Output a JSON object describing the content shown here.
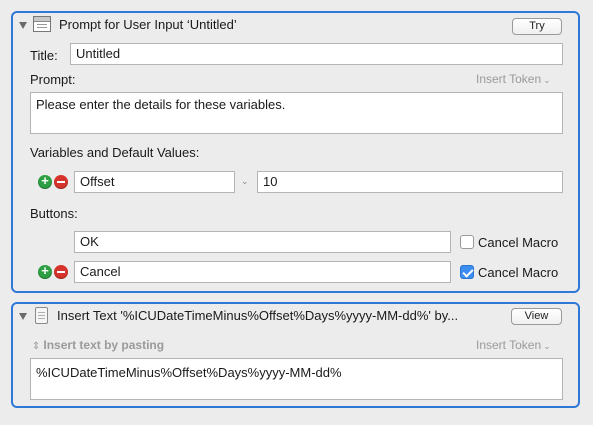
{
  "prompt_action": {
    "title": "Prompt for User Input ‘Untitled’",
    "try_label": "Try",
    "title_label": "Title:",
    "title_value": "Untitled",
    "prompt_label": "Prompt:",
    "insert_token_label": "Insert Token",
    "prompt_text": "Please enter the details for these variables.",
    "variables_label": "Variables and Default Values:",
    "variables": [
      {
        "name": "Offset",
        "default": "10"
      }
    ],
    "buttons_label": "Buttons:",
    "buttons": [
      {
        "label": "OK",
        "cancel_label": "Cancel Macro",
        "cancel_checked": false
      },
      {
        "label": "Cancel",
        "cancel_label": "Cancel Macro",
        "cancel_checked": true
      }
    ]
  },
  "insert_text_action": {
    "title": "Insert Text '%ICUDateTimeMinus%Offset%Days%yyyy-MM-dd%' by...",
    "view_label": "View",
    "mode_label": "Insert text by pasting",
    "insert_token_label": "Insert Token",
    "text": "%ICUDateTimeMinus%Offset%Days%yyyy-MM-dd%"
  },
  "colors": {
    "selection_border": "#2e78d8",
    "add_button": "#2ea043",
    "remove_button": "#d7332d",
    "checkbox_checked": "#3b8ef0"
  },
  "icons": [
    "disclosure-triangle-icon",
    "window-icon",
    "document-icon",
    "add-icon",
    "remove-icon",
    "chevron-down-icon",
    "up-down-arrows-icon",
    "checkmark-icon"
  ]
}
